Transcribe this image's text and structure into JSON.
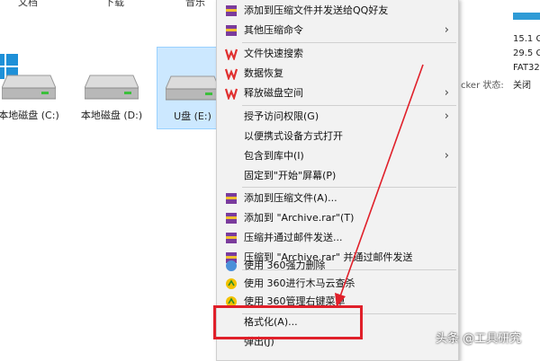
{
  "top_labels": [
    "文档",
    "下载",
    "音乐"
  ],
  "drives": [
    {
      "label": "本地磁盘 (C:)"
    },
    {
      "label": "本地磁盘 (D:)"
    },
    {
      "label": "U盘 (E:)"
    }
  ],
  "menu": {
    "items": [
      {
        "label": "添加到压缩文件并发送给QQ好友",
        "icon": "winrar-icon"
      },
      {
        "label": "其他压缩命令",
        "icon": "winrar-icon",
        "submenu": true
      },
      {
        "label": "文件快速搜索",
        "icon": "wps-icon"
      },
      {
        "label": "数据恢复",
        "icon": "wps-icon"
      },
      {
        "label": "释放磁盘空间",
        "icon": "wps-icon",
        "submenu": true
      },
      {
        "label": "授予访问权限(G)",
        "submenu": true
      },
      {
        "label": "以便携式设备方式打开"
      },
      {
        "label": "包含到库中(I)",
        "submenu": true
      },
      {
        "label": "固定到\"开始\"屏幕(P)"
      },
      {
        "label": "添加到压缩文件(A)...",
        "icon": "winrar-icon"
      },
      {
        "label": "添加到 \"Archive.rar\"(T)",
        "icon": "winrar-icon"
      },
      {
        "label": "压缩并通过邮件发送...",
        "icon": "winrar-icon"
      },
      {
        "label": "压缩到 \"Archive.rar\" 并通过邮件发送",
        "icon": "winrar-icon"
      },
      {
        "label": "使用 360强力删除",
        "icon": "360-icon"
      },
      {
        "label": "使用 360进行木马云查杀",
        "icon": "360-icon"
      },
      {
        "label": "使用 360管理右键菜单",
        "icon": "360-icon"
      },
      {
        "label": "格式化(A)..."
      },
      {
        "label": "弹出(J)"
      }
    ]
  },
  "right_pane": {
    "values": [
      "15.1 G",
      "29.5 G",
      "FAT32",
      "关闭"
    ],
    "bitlocker_label": "cker 状态:"
  },
  "watermark": "头条 @工具研究",
  "colors": {
    "highlight": "#e0202a",
    "selection": "#cce8ff",
    "usage_bar": "#2f9bd6"
  }
}
